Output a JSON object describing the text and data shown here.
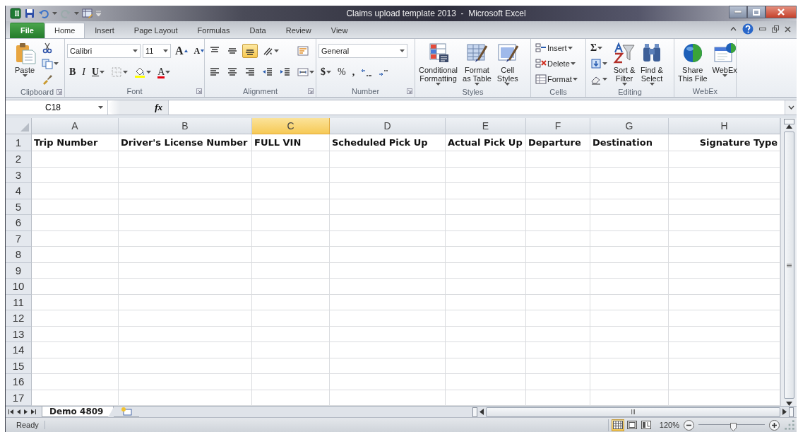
{
  "window": {
    "title": "Claims upload template 2013  -  Microsoft Excel"
  },
  "ribbon_tabs": [
    {
      "label": "File",
      "kind": "file",
      "selected": false
    },
    {
      "label": "Home",
      "kind": "tab",
      "selected": true
    },
    {
      "label": "Insert",
      "kind": "tab",
      "selected": false
    },
    {
      "label": "Page Layout",
      "kind": "tab",
      "selected": false
    },
    {
      "label": "Formulas",
      "kind": "tab",
      "selected": false
    },
    {
      "label": "Data",
      "kind": "tab",
      "selected": false
    },
    {
      "label": "Review",
      "kind": "tab",
      "selected": false
    },
    {
      "label": "View",
      "kind": "tab",
      "selected": false
    }
  ],
  "ribbon_groups": [
    {
      "label": "Clipboard",
      "launcher": true,
      "items": [
        {
          "kind": "large",
          "label": "Paste",
          "dropdown": true
        },
        {
          "kind": "stack",
          "rows": [
            {
              "items": [
                {
                  "kind": "icon",
                  "dropdown": false
                }
              ]
            },
            {
              "items": [
                {
                  "kind": "icon",
                  "dropdown": true
                }
              ]
            },
            {
              "items": [
                {
                  "kind": "icon",
                  "dropdown": false
                }
              ]
            }
          ]
        }
      ]
    },
    {
      "label": "Font",
      "launcher": true,
      "items": [
        {
          "kind": "stack",
          "rows": [
            {
              "items": [
                {
                  "kind": "combo",
                  "value": "Calibri"
                },
                {
                  "kind": "combo",
                  "value": "11"
                },
                {
                  "kind": "grow",
                  "text": "A",
                  "dropdown": false
                },
                {
                  "kind": "shrink",
                  "text": "A",
                  "dropdown": false
                }
              ]
            },
            {
              "items": [
                {
                  "kind": "bold",
                  "text": "B",
                  "dropdown": false
                },
                {
                  "kind": "italic",
                  "text": "I",
                  "dropdown": false
                },
                {
                  "kind": "underline",
                  "text": "U",
                  "dropdown": true
                },
                {
                  "kind": "icon",
                  "dropdown": true
                },
                {
                  "kind": "icon",
                  "dropdown": true,
                  "color": "#ffff00"
                },
                {
                  "kind": "glyph",
                  "text": "A",
                  "dropdown": true,
                  "color": "#e3000f"
                }
              ]
            }
          ]
        }
      ]
    },
    {
      "label": "Alignment",
      "launcher": true,
      "items": [
        {
          "kind": "stack",
          "rows": [
            {
              "items": [
                {
                  "kind": "icon",
                  "dropdown": false,
                  "pressed": false
                },
                {
                  "kind": "icon",
                  "dropdown": false,
                  "pressed": false
                },
                {
                  "kind": "icon",
                  "dropdown": false,
                  "pressed": true
                },
                {
                  "kind": "icon",
                  "dropdown": true,
                  "pressed": false
                }
              ]
            },
            {
              "items": [
                {
                  "kind": "icon",
                  "dropdown": false,
                  "pressed": false
                },
                {
                  "kind": "icon",
                  "dropdown": false,
                  "pressed": false
                },
                {
                  "kind": "icon",
                  "dropdown": false,
                  "pressed": false
                },
                {
                  "kind": "icon",
                  "dropdown": false,
                  "pressed": false
                },
                {
                  "kind": "icon",
                  "dropdown": false,
                  "pressed": false
                }
              ]
            }
          ]
        },
        {
          "kind": "stack",
          "rows": [
            {
              "items": [
                {
                  "kind": "icon",
                  "dropdown": false,
                  "pressed": false
                }
              ]
            },
            {
              "items": [
                {
                  "kind": "icon",
                  "dropdown": true,
                  "pressed": false
                }
              ]
            }
          ]
        }
      ]
    },
    {
      "label": "Number",
      "launcher": true,
      "items": [
        {
          "kind": "stack",
          "rows": [
            {
              "items": [
                {
                  "kind": "combo",
                  "value": "General"
                }
              ]
            },
            {
              "items": [
                {
                  "kind": "bold",
                  "text": "$",
                  "dropdown": true
                },
                {
                  "kind": "glyph",
                  "text": "%",
                  "dropdown": false
                },
                {
                  "kind": "bold",
                  "text": ",",
                  "dropdown": false
                },
                {
                  "kind": "icon",
                  "dropdown": false
                },
                {
                  "kind": "icon",
                  "dropdown": false
                }
              ]
            }
          ]
        }
      ]
    },
    {
      "label": "Styles",
      "launcher": false,
      "items": [
        {
          "kind": "large",
          "label": "Conditional\nFormatting",
          "dropdown": true
        },
        {
          "kind": "large",
          "label": "Format\nas Table",
          "dropdown": true
        },
        {
          "kind": "large",
          "label": "Cell\nStyles",
          "dropdown": true
        }
      ]
    },
    {
      "label": "Cells",
      "launcher": false,
      "items": [
        {
          "kind": "stack",
          "rows": [
            {
              "items": [
                {
                  "kind": "small",
                  "label": "Insert",
                  "dropdown": true
                }
              ]
            },
            {
              "items": [
                {
                  "kind": "small",
                  "label": "Delete",
                  "dropdown": true
                }
              ]
            },
            {
              "items": [
                {
                  "kind": "small",
                  "label": "Format",
                  "dropdown": true
                }
              ]
            }
          ]
        }
      ]
    },
    {
      "label": "Editing",
      "launcher": false,
      "items": [
        {
          "kind": "stack",
          "rows": [
            {
              "items": [
                {
                  "kind": "bold",
                  "text": "Σ",
                  "dropdown": true
                }
              ]
            },
            {
              "items": [
                {
                  "kind": "icon",
                  "dropdown": true
                }
              ]
            },
            {
              "items": [
                {
                  "kind": "icon",
                  "dropdown": true
                }
              ]
            }
          ]
        },
        {
          "kind": "large",
          "label": "Sort &\nFilter",
          "dropdown": true
        },
        {
          "kind": "large",
          "label": "Find &\nSelect",
          "dropdown": true
        }
      ]
    },
    {
      "label": "WebEx",
      "launcher": false,
      "items": [
        {
          "kind": "large",
          "label": "Share\nThis File",
          "dropdown": false
        },
        {
          "kind": "large",
          "label": "WebEx",
          "dropdown": true
        }
      ]
    }
  ],
  "formula_bar": {
    "name_box": "C18",
    "fx": "fx"
  },
  "sheet": {
    "columns": [
      {
        "letter": "A",
        "selected": false
      },
      {
        "letter": "B",
        "selected": false
      },
      {
        "letter": "C",
        "selected": true
      },
      {
        "letter": "D",
        "selected": false
      },
      {
        "letter": "E",
        "selected": false
      },
      {
        "letter": "F",
        "selected": false
      },
      {
        "letter": "G",
        "selected": false
      },
      {
        "letter": "H",
        "selected": false
      }
    ],
    "rows": [
      {
        "number": "1",
        "cells": [
          {
            "text": "Trip Number",
            "kind": "left"
          },
          {
            "text": "Driver's License Number",
            "kind": "left"
          },
          {
            "text": "FULL VIN",
            "kind": "left"
          },
          {
            "text": "Scheduled Pick Up",
            "kind": "left"
          },
          {
            "text": "Actual Pick Up",
            "kind": "left"
          },
          {
            "text": "Departure",
            "kind": "left"
          },
          {
            "text": "Destination",
            "kind": "left"
          },
          {
            "text": "Signature Type",
            "kind": "right"
          }
        ]
      },
      {
        "number": "2"
      },
      {
        "number": "3"
      },
      {
        "number": "4"
      },
      {
        "number": "5"
      },
      {
        "number": "6"
      },
      {
        "number": "7"
      },
      {
        "number": "8"
      },
      {
        "number": "9"
      },
      {
        "number": "10"
      },
      {
        "number": "11"
      },
      {
        "number": "12"
      },
      {
        "number": "13"
      },
      {
        "number": "14"
      },
      {
        "number": "15"
      },
      {
        "number": "16"
      },
      {
        "number": "17"
      }
    ]
  },
  "sheet_tabs": [
    {
      "label": "Demo 4809",
      "selected": true
    }
  ],
  "status_bar": {
    "text": "Ready",
    "views": [
      {
        "selected": true
      },
      {
        "selected": false
      },
      {
        "selected": false
      }
    ],
    "zoom": "120%",
    "zoom_slider": {
      "level": 0.53
    }
  }
}
